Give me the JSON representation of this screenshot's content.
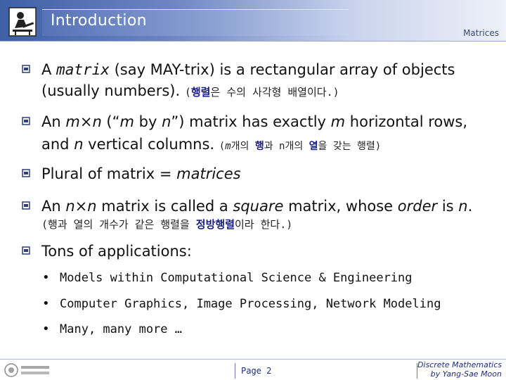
{
  "header": {
    "title": "Introduction",
    "course_tag": "Matrices"
  },
  "bullets": [
    {
      "line1": {
        "a": "A ",
        "b": "matrix",
        "c": " (say MAY-trix) is a rectangular array of objects"
      },
      "line2": {
        "a": "(usually numbers). ",
        "kr_open": "(",
        "kr_bold": "행렬",
        "kr_rest": "은 수의 사각형 배열이다.)"
      }
    },
    {
      "line1": {
        "a": "An ",
        "b": "m",
        "c": "×",
        "d": "n",
        "e": " (“",
        "f": "m",
        "g": " by ",
        "h": "n",
        "i": "”) matrix has exactly ",
        "j": "m",
        "k": " horizontal rows,"
      },
      "line2": {
        "a": "and ",
        "b": "n",
        "c": " vertical columns. ",
        "kr_open": "(",
        "kr_m": "m",
        "kr_1": "개의 ",
        "kr_bold1": "행",
        "kr_2": "과 n개의 ",
        "kr_bold2": "열",
        "kr_3": "을 갖는 행렬)"
      }
    },
    {
      "line1": {
        "a": "Plural of matrix = ",
        "b": "matrices"
      }
    },
    {
      "line1": {
        "a": "An ",
        "b": "n",
        "c": "×",
        "d": "n",
        "e": " matrix is called a ",
        "f": "square",
        "g": " matrix, whose ",
        "h": "order",
        "i": " is ",
        "j": "n",
        "k": "."
      },
      "line2": {
        "kr_1": "(행과 열의 개수가 같은 행렬을 ",
        "kr_bold": "정방행렬",
        "kr_2": "이라 한다.)"
      }
    },
    {
      "line1": {
        "a": "Tons of applications:"
      }
    }
  ],
  "sub_bullets": [
    {
      "marker": "•",
      "text": "Models within Computational Science & Engineering"
    },
    {
      "marker": "•",
      "text": "Computer Graphics, Image Processing, Network Modeling"
    },
    {
      "marker": "•",
      "text": "Many, many more …"
    }
  ],
  "footer": {
    "page": "Page 2",
    "course_line1": "Discrete Mathematics",
    "course_line2": "by Yang-Sae Moon"
  },
  "colors": {
    "header_band": "#3f5fa6",
    "accent_text": "#1f2f7a",
    "bullet_icon": "#2c3f7c"
  },
  "icons": {
    "header_logo": "person-at-desk-icon",
    "bullet": "box-bullet-icon",
    "footer_logo": "university-logo-icon"
  }
}
